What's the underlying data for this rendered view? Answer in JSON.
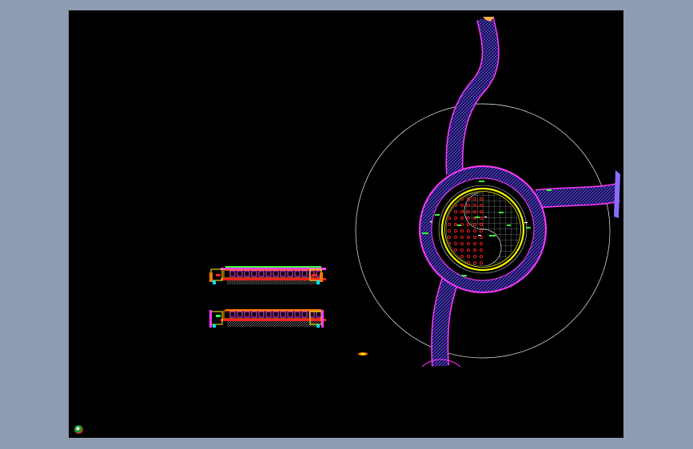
{
  "window": {
    "background_color": "#8e9bb0",
    "viewport_color": "#000000"
  },
  "drawing": {
    "colors": {
      "paving": "#4b3cff",
      "edge": "#ff39ff",
      "boundary_circle": "#f0f0f0",
      "inner_ring": "#f5f500",
      "inner_grid": "#d8d8d8",
      "red_dots": "#ff2020",
      "green_marks": "#38ff38",
      "section_orange": "#ff7a00",
      "section_yellow": "#ffff00",
      "section_red": "#ff2020",
      "section_cyan": "#00e5ff",
      "section_magenta": "#ff39ff",
      "section_grey": "#9a9a9a"
    },
    "icons": [
      "ucs-icon"
    ]
  }
}
